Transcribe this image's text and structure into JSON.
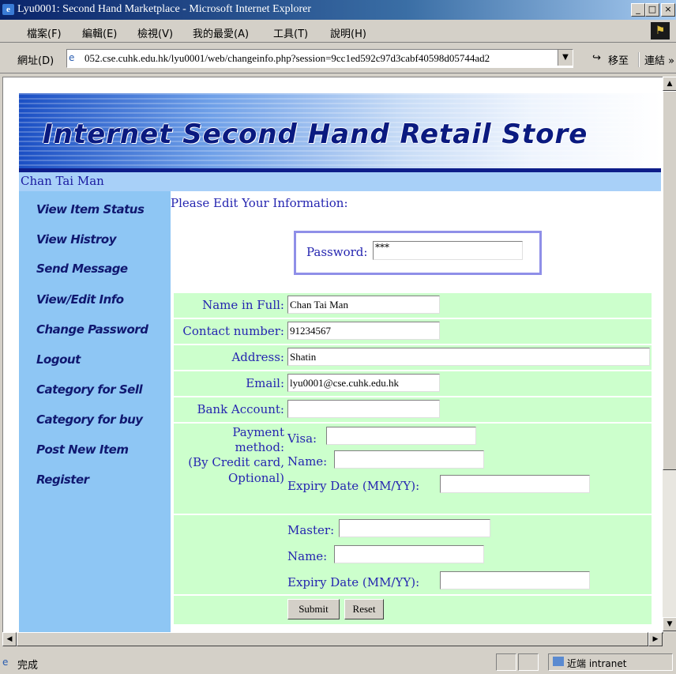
{
  "window": {
    "title": "Lyu0001: Second Hand Marketplace - Microsoft Internet Explorer",
    "controls": [
      "_",
      "□",
      "×"
    ]
  },
  "menu": [
    "檔案(F)",
    "編輯(E)",
    "檢視(V)",
    "我的最愛(A)",
    "工具(T)",
    "說明(H)"
  ],
  "address": {
    "label": "網址(D)",
    "url": "052.cse.cuhk.edu.hk/lyu0001/web/changeinfo.php?session=9cc1ed592c97d3cabf40598d05744ad2",
    "go": "移至",
    "links": "連結 »"
  },
  "banner": {
    "title": "Internet Second Hand Retail Store"
  },
  "user": {
    "name": "Chan Tai Man"
  },
  "nav": [
    "View Item Status",
    "View Histroy",
    "Send Message",
    "View/Edit Info",
    "Change Password",
    "Logout",
    "Category for Sell",
    "Category for buy",
    "Post New Item",
    "Register"
  ],
  "form": {
    "prompt": "Please Edit Your Information:",
    "password_label": "Password:",
    "password_value": "***",
    "name_label": "Name in Full:",
    "name_value": "Chan Tai Man",
    "contact_label": "Contact number:",
    "contact_value": "91234567",
    "address_label": "Address:",
    "address_value": "Shatin",
    "email_label": "Email:",
    "email_value": "lyu0001@cse.cuhk.edu.hk",
    "bank_label": "Bank Account:",
    "bank_value": "",
    "payment_label_1": "Payment",
    "payment_label_2": "method:",
    "payment_label_3": "(By Credit card,",
    "payment_label_4": "Optional)",
    "visa_label": "Visa:",
    "visa_name_label": "Name:",
    "visa_expiry_label": "Expiry Date (MM/YY):",
    "master_label": "Master:",
    "master_name_label": "Name:",
    "master_expiry_label": "Expiry Date (MM/YY):",
    "submit": "Submit",
    "reset": "Reset"
  },
  "status": {
    "text": "完成",
    "zone": "近端 intranet"
  }
}
